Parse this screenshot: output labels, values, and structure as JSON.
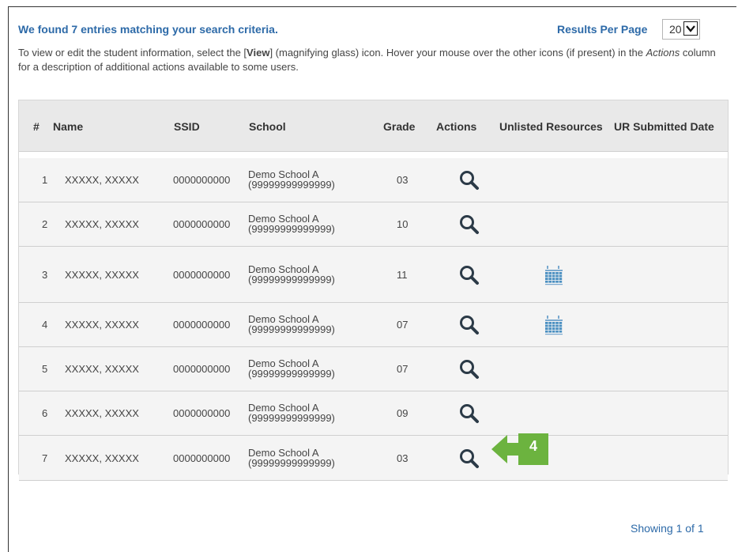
{
  "header": {
    "found_text": "We found 7 entries matching your search criteria.",
    "results_per_page_label": "Results Per Page",
    "results_per_page_value": "20"
  },
  "instructions": {
    "part1": "To view or edit the student information, select the [",
    "view_word": "View",
    "part2": "] (magnifying glass) icon. Hover your mouse over the other icons (if present) in the ",
    "actions_word": "Actions",
    "part3": " column for a description of additional actions available to some users."
  },
  "table": {
    "columns": [
      "#",
      "Name",
      "SSID",
      "School",
      "Grade",
      "Actions",
      "Unlisted Resources",
      "UR Submitted Date"
    ],
    "rows": [
      {
        "num": "1",
        "name": "XXXXX, XXXXX",
        "ssid": "0000000000",
        "school_name": "Demo School A",
        "school_id": "(99999999999999)",
        "grade": "03",
        "ur_icon": false
      },
      {
        "num": "2",
        "name": "XXXXX, XXXXX",
        "ssid": "0000000000",
        "school_name": "Demo School A",
        "school_id": "(99999999999999)",
        "grade": "10",
        "ur_icon": false
      },
      {
        "num": "3",
        "name": "XXXXX, XXXXX",
        "ssid": "0000000000",
        "school_name": "Demo School A",
        "school_id": "(99999999999999)",
        "grade": "11",
        "ur_icon": true
      },
      {
        "num": "4",
        "name": "XXXXX, XXXXX",
        "ssid": "0000000000",
        "school_name": "Demo School A",
        "school_id": "(99999999999999)",
        "grade": "07",
        "ur_icon": true
      },
      {
        "num": "5",
        "name": "XXXXX, XXXXX",
        "ssid": "0000000000",
        "school_name": "Demo School A",
        "school_id": "(99999999999999)",
        "grade": "07",
        "ur_icon": false
      },
      {
        "num": "6",
        "name": "XXXXX, XXXXX",
        "ssid": "0000000000",
        "school_name": "Demo School A",
        "school_id": "(99999999999999)",
        "grade": "09",
        "ur_icon": false
      },
      {
        "num": "7",
        "name": "XXXXX, XXXXX",
        "ssid": "0000000000",
        "school_name": "Demo School A",
        "school_id": "(99999999999999)",
        "grade": "03",
        "ur_icon": false
      }
    ],
    "action_icon": "magnifying-glass-icon",
    "ur_icon": "calendar-icon"
  },
  "pagination": {
    "showing_text": "Showing 1 of 1"
  },
  "callout": {
    "number": "4",
    "color": "#6cb33f"
  },
  "colors": {
    "accent": "#2d6aa8",
    "header_bg": "#e9e9e9",
    "row_bg": "#f4f4f4",
    "icon_dark": "#2b3a47",
    "calendar_blue": "#4a8fc1"
  }
}
